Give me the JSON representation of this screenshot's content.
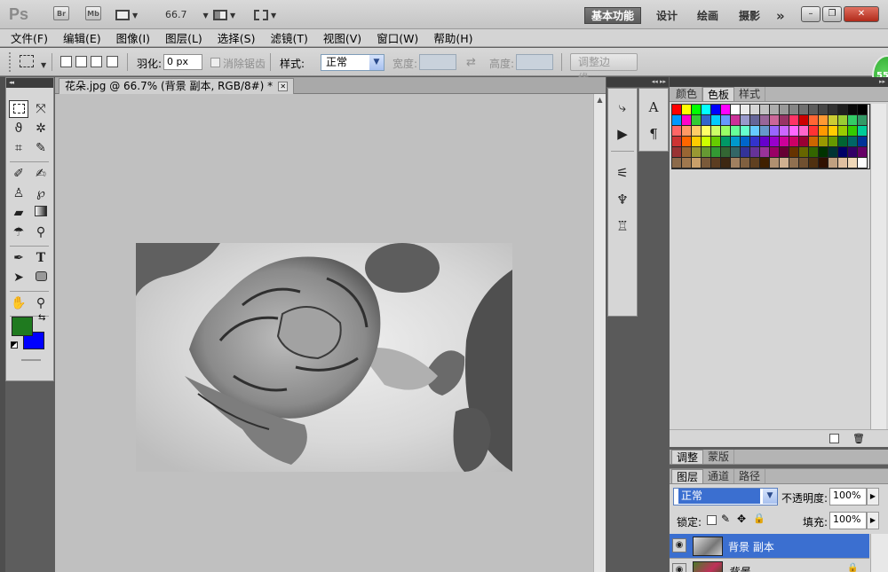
{
  "app": {
    "logo": "Ps",
    "bridge_label": "Br",
    "minibridge_label": "Mb",
    "zoom": "66.7",
    "workspaces": [
      "基本功能",
      "设计",
      "绘画",
      "摄影"
    ],
    "more_label": "»",
    "window_controls": [
      "–",
      "❐",
      "✕"
    ]
  },
  "menu": [
    "文件(F)",
    "编辑(E)",
    "图像(I)",
    "图层(L)",
    "选择(S)",
    "滤镜(T)",
    "视图(V)",
    "窗口(W)",
    "帮助(H)"
  ],
  "options": {
    "feather_label": "羽化:",
    "feather_value": "0 px",
    "antialias_label": "消除锯齿",
    "style_label": "样式:",
    "style_value": "正常",
    "width_label": "宽度:",
    "height_label": "高度:",
    "refine_edge_label": "调整边缘..."
  },
  "badge": "55",
  "document": {
    "tab_title": "花朵.jpg @ 66.7% (背景 副本, RGB/8#) *",
    "close_label": "✕"
  },
  "panels": {
    "swatches_tabs": [
      "颜色",
      "色板",
      "样式"
    ],
    "swatches_active": "色板",
    "adjust_tabs": [
      "调整",
      "蒙版"
    ],
    "layers_tabs": [
      "图层",
      "通道",
      "路径"
    ],
    "blend_mode": "正常",
    "opacity_label": "不透明度:",
    "opacity_value": "100%",
    "lock_label": "锁定:",
    "fill_label": "填充:",
    "fill_value": "100%",
    "layers": [
      {
        "name": "背景 副本",
        "selected": true
      },
      {
        "name": "背景",
        "selected": false
      }
    ]
  },
  "colors": {
    "foreground": "#1f7a1f",
    "background": "#0000ff",
    "layer_selected": "#3b6fd0",
    "workspace_active": "#666666"
  },
  "swatches": [
    "#ff0000",
    "#ffff00",
    "#00ff00",
    "#00ffff",
    "#0000ff",
    "#ff00ff",
    "#ffffff",
    "#ebebeb",
    "#d6d6d6",
    "#c2c2c2",
    "#adadad",
    "#999999",
    "#858585",
    "#707070",
    "#5c5c5c",
    "#474747",
    "#333333",
    "#1f1f1f",
    "#0a0a0a",
    "#000000",
    "#0099ff",
    "#ff00cc",
    "#33cc33",
    "#3366cc",
    "#00ccff",
    "#6699ff",
    "#cc3399",
    "#9999cc",
    "#666699",
    "#996699",
    "#cc6699",
    "#993366",
    "#ff3366",
    "#cc0000",
    "#ff6633",
    "#ff9933",
    "#cccc33",
    "#99cc33",
    "#33cc66",
    "#339966",
    "#ff6666",
    "#ff9966",
    "#ffcc66",
    "#ffff66",
    "#ccff66",
    "#99ff66",
    "#66ff99",
    "#66ffcc",
    "#66ccff",
    "#6699cc",
    "#9966ff",
    "#cc66ff",
    "#ff66ff",
    "#ff66cc",
    "#ff3333",
    "#ff9900",
    "#ffcc00",
    "#99cc00",
    "#33cc00",
    "#00cc99",
    "#cc3333",
    "#ff6600",
    "#ffcc00",
    "#ccff00",
    "#66cc00",
    "#009966",
    "#0099cc",
    "#0066cc",
    "#3333cc",
    "#6600cc",
    "#9900cc",
    "#cc0099",
    "#cc0066",
    "#990033",
    "#cc6600",
    "#999900",
    "#669900",
    "#006633",
    "#006666",
    "#003399",
    "#993333",
    "#996633",
    "#999933",
    "#669933",
    "#339933",
    "#336633",
    "#336666",
    "#333399",
    "#663399",
    "#993399",
    "#990066",
    "#660033",
    "#663300",
    "#666600",
    "#336600",
    "#003300",
    "#003333",
    "#000066",
    "#330066",
    "#660066",
    "#8c6a4a",
    "#a0784e",
    "#c9a06a",
    "#7a5a3a",
    "#5c3d21",
    "#3d2712",
    "#a08060",
    "#806040",
    "#604020",
    "#402000",
    "#b09070",
    "#d0b090",
    "#907050",
    "#705030",
    "#503010",
    "#301000",
    "#c0a080",
    "#e0c0a0",
    "#f0d8b8",
    "#ffffff"
  ]
}
